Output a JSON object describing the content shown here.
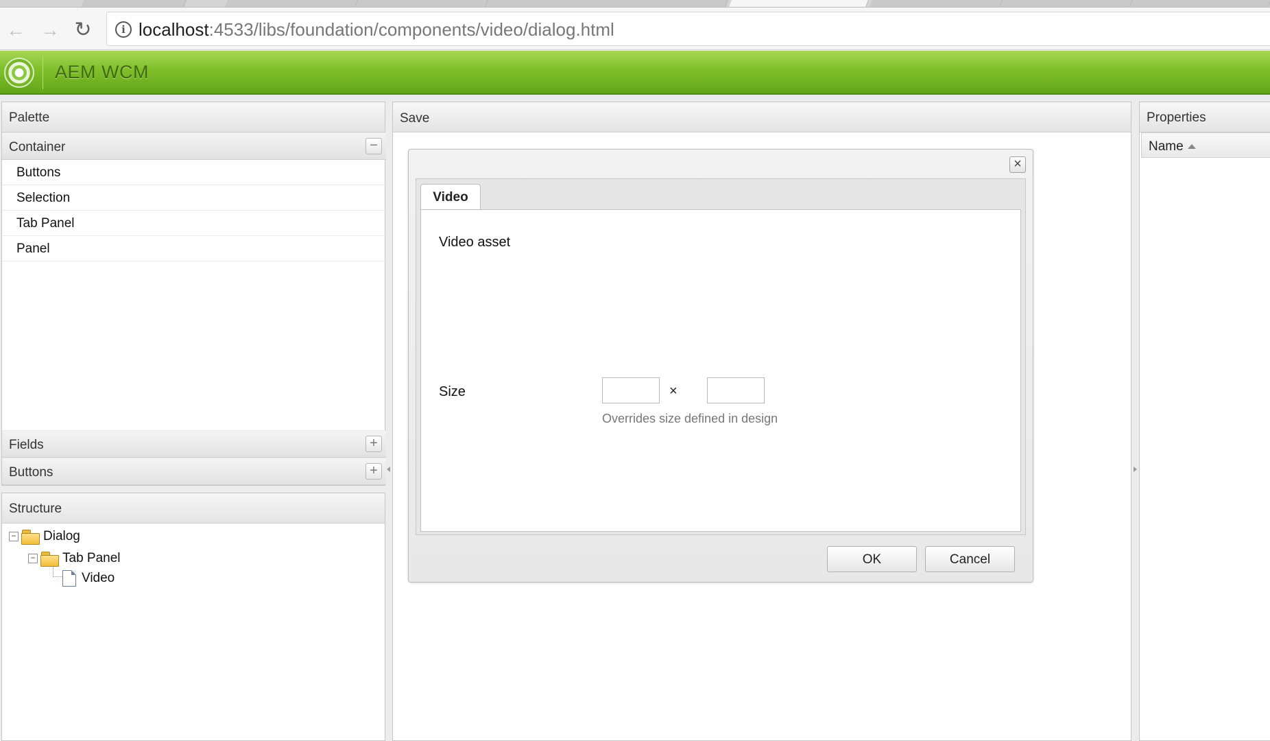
{
  "browser": {
    "url_host": "localhost",
    "url_path": ":4533/libs/foundation/components/video/dialog.html",
    "back_icon": "←",
    "forward_icon": "→",
    "reload_icon": "↻",
    "info_icon": "i"
  },
  "app": {
    "title": "AEM WCM"
  },
  "palette": {
    "title": "Palette",
    "container_label": "Container",
    "container_toggle": "−",
    "items": [
      {
        "label": "Buttons"
      },
      {
        "label": "Selection"
      },
      {
        "label": "Tab Panel"
      },
      {
        "label": "Panel"
      }
    ],
    "fields_label": "Fields",
    "fields_toggle": "+",
    "buttons_label": "Buttons",
    "buttons_toggle": "+"
  },
  "structure": {
    "title": "Structure",
    "tree": {
      "root": "Dialog",
      "child": "Tab Panel",
      "leaf": "Video",
      "toggle": "−"
    }
  },
  "editor": {
    "save_label": "Save"
  },
  "dialog": {
    "close_icon": "×",
    "tab_label": "Video",
    "video_asset_label": "Video asset",
    "size_label": "Size",
    "size_separator": "×",
    "size_width": "",
    "size_height": "",
    "size_hint": "Overrides size defined in design",
    "ok_label": "OK",
    "cancel_label": "Cancel"
  },
  "properties": {
    "title": "Properties",
    "name_column": "Name"
  }
}
